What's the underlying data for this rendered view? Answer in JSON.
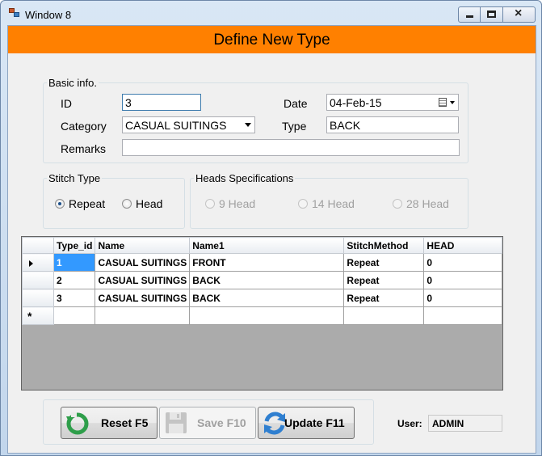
{
  "window": {
    "title": "Window   8"
  },
  "header": {
    "title": "Define New Type",
    "bg_color": "#ff8000"
  },
  "basic_info": {
    "legend": "Basic info.",
    "id_label": "ID",
    "id_value": "3",
    "date_label": "Date",
    "date_value": "04-Feb-15",
    "category_label": "Category",
    "category_value": "CASUAL SUITINGS",
    "type_label": "Type",
    "type_value": "BACK",
    "remarks_label": "Remarks",
    "remarks_value": ""
  },
  "stitch_type": {
    "legend": "Stitch Type",
    "options": [
      {
        "label": "Repeat",
        "selected": true
      },
      {
        "label": "Head",
        "selected": false
      }
    ]
  },
  "heads_spec": {
    "legend": "Heads Specifications",
    "options": [
      {
        "label": "9 Head",
        "enabled": false
      },
      {
        "label": "14 Head",
        "enabled": false
      },
      {
        "label": "28 Head",
        "enabled": false
      }
    ]
  },
  "grid": {
    "columns": [
      "Type_id",
      "Name",
      "Name1",
      "StitchMethod",
      "HEAD"
    ],
    "rows": [
      {
        "type_id": "1",
        "name": "CASUAL SUITINGS",
        "name1": "FRONT",
        "stitch": "Repeat",
        "head": "0"
      },
      {
        "type_id": "2",
        "name": "CASUAL SUITINGS",
        "name1": "BACK",
        "stitch": "Repeat",
        "head": "0"
      },
      {
        "type_id": "3",
        "name": "CASUAL SUITINGS",
        "name1": "BACK",
        "stitch": "Repeat",
        "head": "0"
      }
    ]
  },
  "buttons": {
    "reset": "Reset F5",
    "save": "Save F10",
    "update": "Update F11"
  },
  "user": {
    "label": "User:",
    "value": "ADMIN"
  }
}
